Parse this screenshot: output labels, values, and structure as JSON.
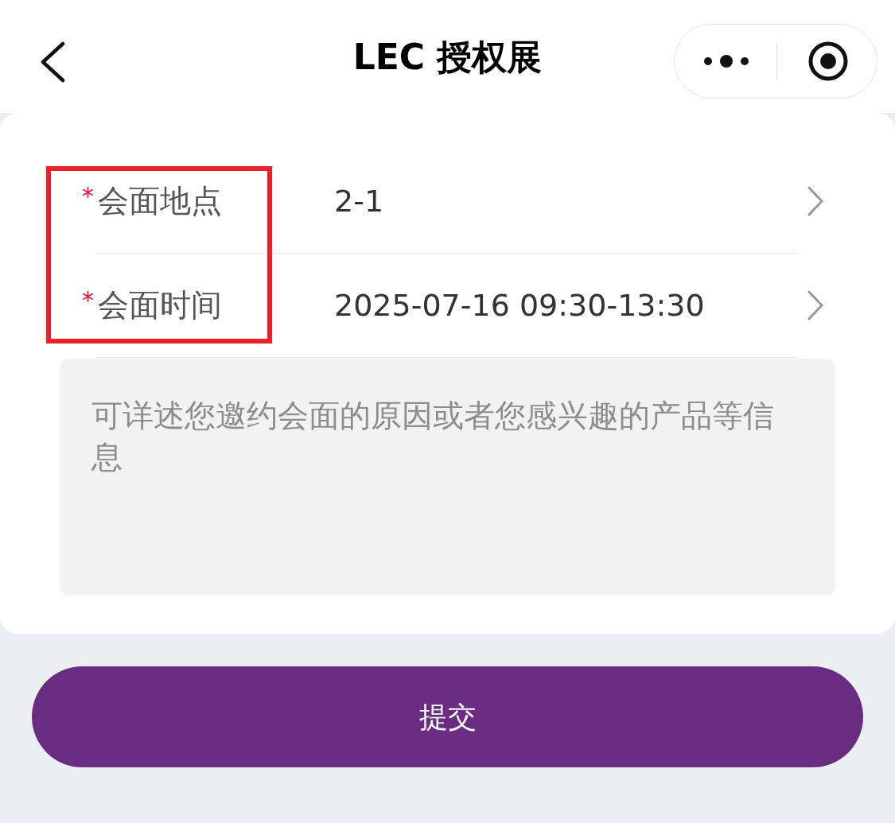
{
  "header": {
    "title": "LEC 授权展"
  },
  "fields": [
    {
      "required_mark": "*",
      "label": "会面地点",
      "value": "2-1"
    },
    {
      "required_mark": "*",
      "label": "会面时间",
      "value": "2025-07-16 09:30-13:30"
    }
  ],
  "message": {
    "placeholder": "可详述您邀约会面的原因或者您感兴趣的产品等信息"
  },
  "labels_highlighted": true,
  "submit_button": "提交"
}
